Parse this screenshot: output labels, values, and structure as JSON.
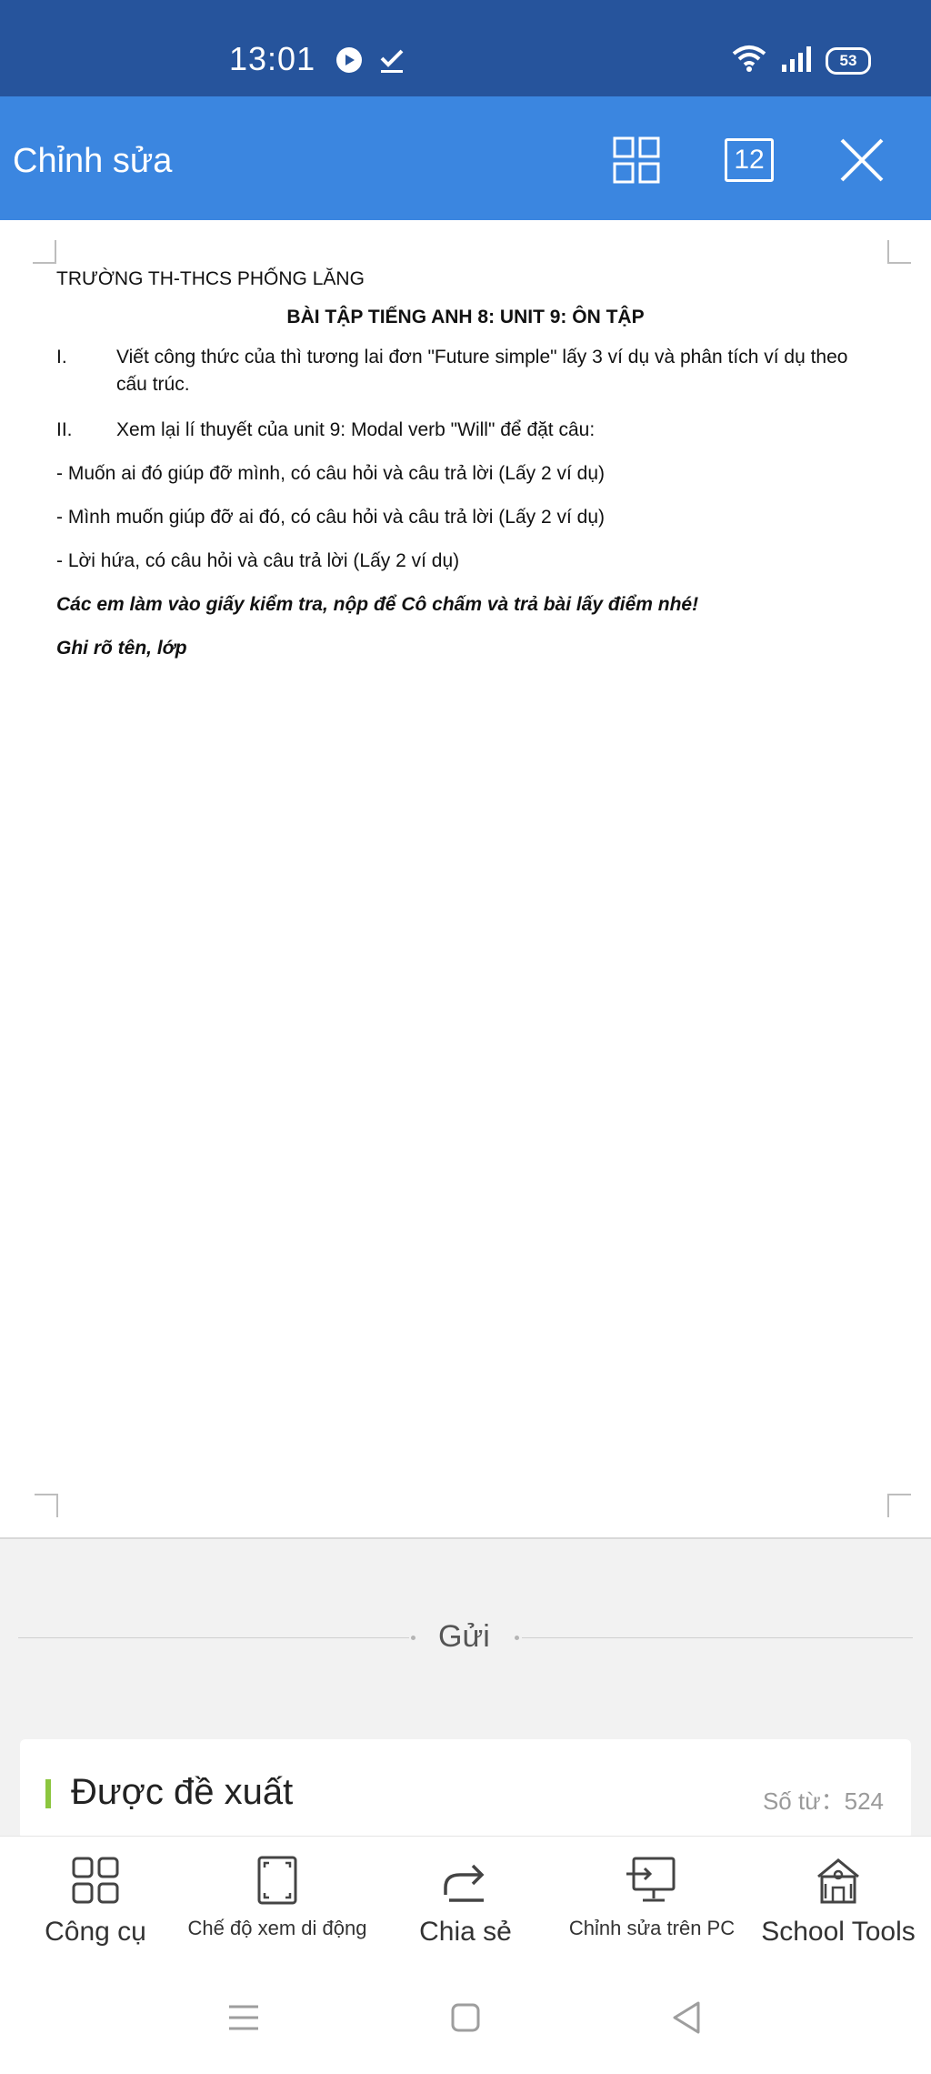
{
  "status_bar": {
    "time": "13:01",
    "battery": "53"
  },
  "app_bar": {
    "title": "Chỉnh sửa",
    "page_number": "12"
  },
  "document": {
    "school": "TRƯỜNG TH-THCS PHỐNG LĂNG",
    "heading": "BÀI TẬP TIẾNG ANH 8: UNIT 9: ÔN TẬP",
    "items": [
      {
        "num": "I.",
        "text": "Viết công thức của thì tương lai đơn \"Future simple\" lấy 3 ví dụ và phân tích ví dụ theo cấu trúc."
      },
      {
        "num": "II.",
        "text": "Xem lại lí thuyết của unit 9: Modal verb \"Will\" để đặt câu:"
      }
    ],
    "lines": [
      "- Muốn ai đó giúp đỡ mình, có câu hỏi và câu trả lời (Lấy 2 ví dụ)",
      "- Mình muốn giúp đỡ ai đó, có câu hỏi và câu trả lời (Lấy 2 ví dụ)",
      "- Lời hứa, có câu hỏi và câu trả lời (Lấy 2 ví dụ)"
    ],
    "note1": "Các em làm vào giấy kiểm tra, nộp để Cô chấm và trả bài lấy điểm nhé!",
    "note2": "Ghi rõ tên, lớp"
  },
  "send_label": "Gửi",
  "recommend": {
    "title": "Được đề xuất",
    "word_count": "Số từ：524"
  },
  "toolbar": {
    "tools": "Công cụ",
    "mobile_view": "Chế độ xem di động",
    "share": "Chia sẻ",
    "edit_pc": "Chỉnh sửa trên PC",
    "school_tools": "School Tools"
  },
  "colors": {
    "status_bar": "#26549c",
    "app_bar": "#3b86e0",
    "accent_green": "#8cc63f"
  }
}
